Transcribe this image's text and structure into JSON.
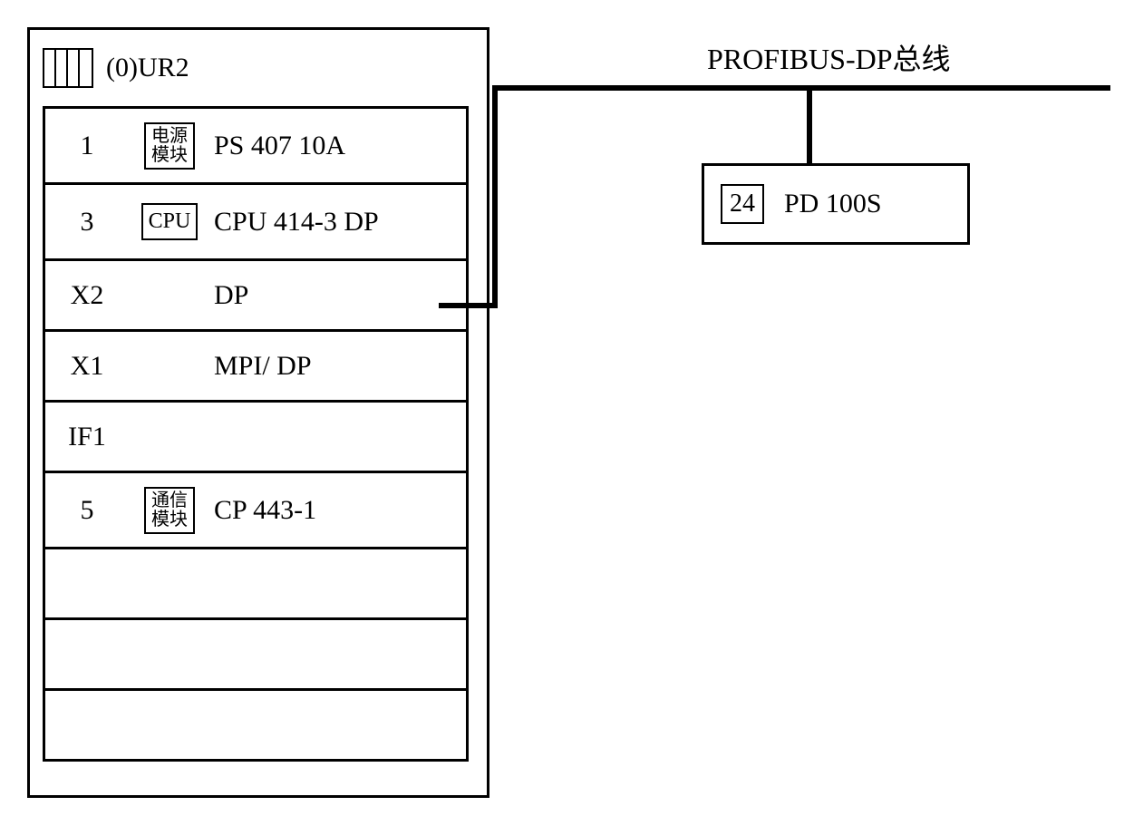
{
  "rack": {
    "title": "(0)UR2",
    "slots": [
      {
        "num": "1",
        "chip": "电源\n模块",
        "desc": "PS 407 10A"
      },
      {
        "num": "3",
        "chip": "CPU",
        "desc": "CPU 414-3 DP"
      },
      {
        "num": "X2",
        "chip": "",
        "desc": "DP"
      },
      {
        "num": "X1",
        "chip": "",
        "desc": "MPI/ DP"
      },
      {
        "num": "IF1",
        "chip": "",
        "desc": ""
      },
      {
        "num": "5",
        "chip": "通信\n模块",
        "desc": "CP 443-1"
      },
      {
        "num": "",
        "chip": "",
        "desc": ""
      },
      {
        "num": "",
        "chip": "",
        "desc": ""
      },
      {
        "num": "",
        "chip": "",
        "desc": ""
      }
    ]
  },
  "bus": {
    "label": "PROFIBUS-DP总线"
  },
  "device": {
    "addr": "24",
    "name": "PD 100S"
  }
}
